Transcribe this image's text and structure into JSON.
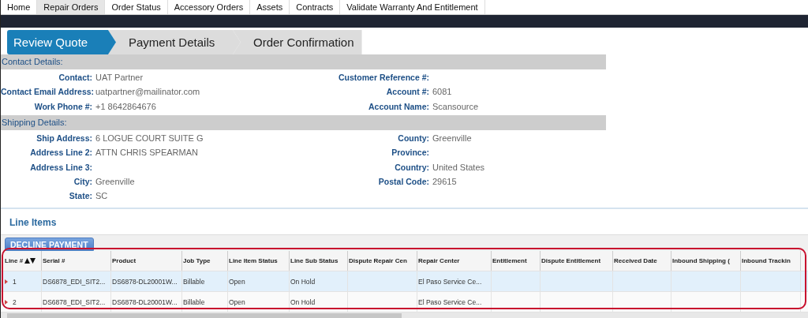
{
  "nav": [
    {
      "label": "Home",
      "selected": false
    },
    {
      "label": "Repair Orders",
      "selected": true
    },
    {
      "label": "Order Status",
      "selected": false
    },
    {
      "label": "Accessory Orders",
      "selected": false
    },
    {
      "label": "Assets",
      "selected": false
    },
    {
      "label": "Contracts",
      "selected": false
    },
    {
      "label": "Validate Warranty And Entitlement",
      "selected": false
    }
  ],
  "steps": [
    {
      "label": "Review Quote",
      "selected": true
    },
    {
      "label": "Payment Details",
      "selected": false
    },
    {
      "label": "Order Confirmation",
      "selected": false
    }
  ],
  "sections": [
    {
      "title": "Contact Details:",
      "left_fields": [
        {
          "label": "Contact:",
          "value": "UAT Partner"
        },
        {
          "label": "Contact Email Address:",
          "value": "uatpartner@mailinator.com"
        },
        {
          "label": "Work Phone #:",
          "value": "+1 8642864676"
        }
      ],
      "right_fields": [
        {
          "label": "Customer Reference #:"
        },
        {
          "label": "Account #:",
          "value": "6081"
        },
        {
          "label": "Account Name:",
          "value": "Scansource"
        }
      ]
    },
    {
      "title": "Shipping Details:",
      "left_fields": [
        {
          "label": "Ship Address:",
          "value": "6 LOGUE COURT SUITE G"
        },
        {
          "label": "Address Line 2:",
          "value": "ATTN CHRIS SPEARMAN"
        },
        {
          "label": "Address Line 3:"
        },
        {
          "label": "City:",
          "value": "Greenville"
        },
        {
          "label": "State:",
          "value": "SC"
        }
      ],
      "right_fields": [
        {
          "label": "County:",
          "value": "Greenville"
        },
        {
          "label": "Province:"
        },
        {
          "label": "Country:",
          "value": "United States"
        },
        {
          "label": "Postal Code:",
          "value": "29615"
        }
      ]
    }
  ],
  "line_items": {
    "title": "Line Items",
    "action": "DECLINE PAYMENT",
    "columns": [
      "Line #",
      "Serial #",
      "Product",
      "Job Type",
      "Line Item Status",
      "Line Sub Status",
      "Dispute Repair Cen",
      "Repair Center",
      "Entitlement",
      "Dispute Entitlement",
      "Received Date",
      "Inbound Shipping (",
      "Inbound Trackin"
    ],
    "rows": [
      {
        "selected": true,
        "cells": [
          "1",
          "DS6878_EDI_SIT2...",
          "DS6878-DL20001W...",
          "Billable",
          "Open",
          "On Hold",
          "",
          "El Paso Service Ce...",
          "",
          "",
          "",
          "",
          ""
        ]
      },
      {
        "selected": false,
        "cells": [
          "2",
          "DS6878_EDI_SIT2...",
          "DS6878-DL20001W...",
          "Billable",
          "Open",
          "On Hold",
          "",
          "El Paso Service Ce...",
          "",
          "",
          "",
          "",
          ""
        ]
      }
    ]
  }
}
